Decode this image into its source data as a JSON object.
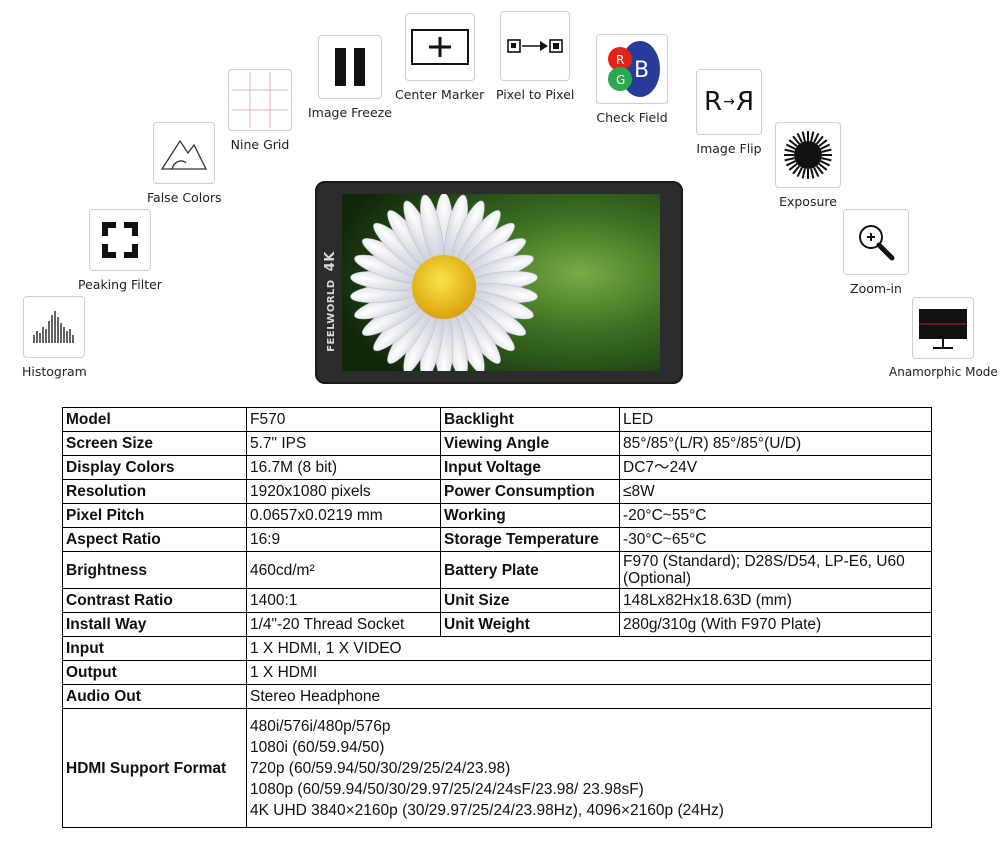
{
  "features": [
    {
      "id": "histogram",
      "label": "Histogram",
      "icon": "histogram-icon"
    },
    {
      "id": "peaking-filter",
      "label": "Peaking Filter",
      "icon": "peaking-filter-icon"
    },
    {
      "id": "false-colors",
      "label": "False Colors",
      "icon": "false-colors-icon"
    },
    {
      "id": "nine-grid",
      "label": "Nine Grid",
      "icon": "nine-grid-icon"
    },
    {
      "id": "image-freeze",
      "label": "Image Freeze",
      "icon": "pause-icon"
    },
    {
      "id": "center-marker",
      "label": "Center Marker",
      "icon": "center-marker-icon"
    },
    {
      "id": "pixel-to-pixel",
      "label": "Pixel to Pixel",
      "icon": "pixel-to-pixel-icon"
    },
    {
      "id": "check-field",
      "label": "Check Field",
      "icon": "rgb-check-field-icon"
    },
    {
      "id": "image-flip",
      "label": "Image Flip",
      "icon": "image-flip-icon"
    },
    {
      "id": "exposure",
      "label": "Exposure",
      "icon": "exposure-icon"
    },
    {
      "id": "zoom-in",
      "label": "Zoom-in",
      "icon": "zoom-in-icon"
    },
    {
      "id": "anamorphic-mode",
      "label": "Anamorphic Mode",
      "icon": "anamorphic-icon"
    }
  ],
  "icon_text": {
    "check_r": "R",
    "check_g": "G",
    "check_b": "B",
    "flip_left": "R",
    "flip_right": "R"
  },
  "monitor": {
    "brand": "FEELWORLD",
    "badge": "4K"
  },
  "spec_table": {
    "rows": [
      {
        "k1": "Model",
        "v1": "F570",
        "k2": "Backlight",
        "v2": "LED"
      },
      {
        "k1": "Screen Size",
        "v1": "5.7\" IPS",
        "k2": "Viewing Angle",
        "v2": "85°/85°(L/R) 85°/85°(U/D)"
      },
      {
        "k1": "Display Colors",
        "v1": "16.7M (8 bit)",
        "k2": "Input Voltage",
        "v2": "DC7～24V"
      },
      {
        "k1": "Resolution",
        "v1": "1920x1080 pixels",
        "k2": "Power Consumption",
        "v2": "≤8W"
      },
      {
        "k1": "Pixel Pitch",
        "v1": "0.0657x0.0219 mm",
        "k2": "Working",
        "v2": "-20°C~55°C"
      },
      {
        "k1": "Aspect Ratio",
        "v1": "16:9",
        "k2": "Storage Temperature",
        "v2": "-30°C~65°C"
      },
      {
        "k1": "Brightness",
        "v1": "460cd/m²",
        "k2": "Battery Plate",
        "v2": "F970 (Standard); D28S/D54, LP-E6, U60 (Optional)"
      },
      {
        "k1": "Contrast Ratio",
        "v1": "1400:1",
        "k2": "Unit Size",
        "v2": "148Lx82Hx18.63D (mm)"
      },
      {
        "k1": "Install Way",
        "v1": "1/4\"-20 Thread Socket",
        "k2": "Unit Weight",
        "v2": "280g/310g (With F970 Plate)"
      }
    ],
    "wide_rows": [
      {
        "k": "Input",
        "v": "1 X HDMI, 1 X VIDEO"
      },
      {
        "k": "Output",
        "v": "1 X HDMI"
      },
      {
        "k": "Audio Out",
        "v": "Stereo Headphone"
      }
    ],
    "hdmi": {
      "k": "HDMI Support Format",
      "lines": [
        "480i/576i/480p/576p",
        "1080i (60/59.94/50)",
        "720p (60/59.94/50/30/29/25/24/23.98)",
        "1080p (60/59.94/50/30/29.97/25/24/24sF/23.98/ 23.98sF)",
        "4K UHD 3840×2160p (30/29.97/25/24/23.98Hz), 4096×2160p (24Hz)"
      ]
    }
  },
  "colors": {
    "check_red": "#e2231a",
    "check_green": "#2aa84a",
    "check_blue": "#283a9a",
    "flower_center": "#f4d21a",
    "foliage": "#3a6e22"
  }
}
